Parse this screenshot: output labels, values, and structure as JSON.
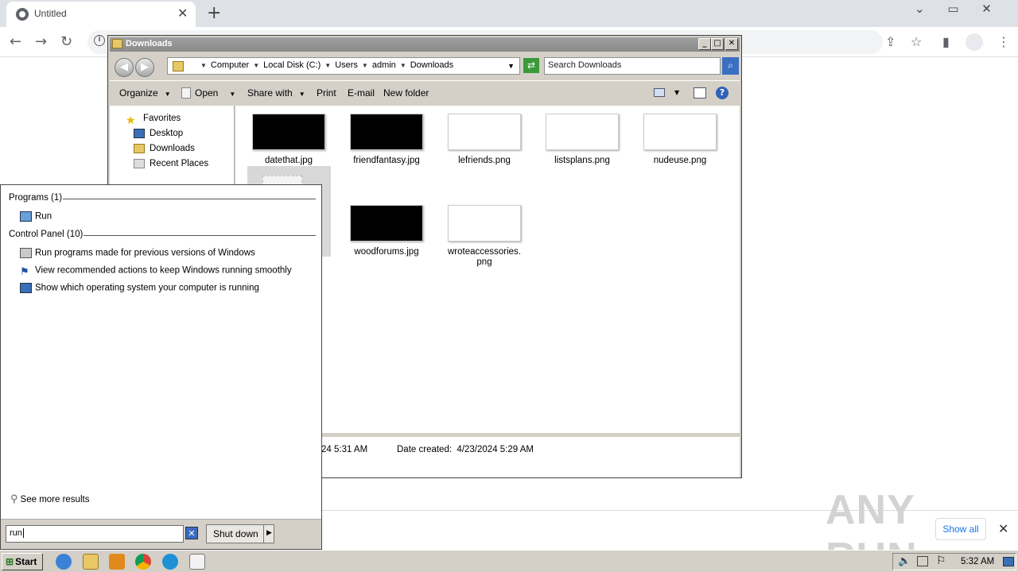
{
  "browser": {
    "tab_title": "Untitled",
    "tab_close": "✕",
    "new_tab": "+",
    "window_controls": "⌄ ▭ ✕",
    "nav": {
      "back": "←",
      "forward": "→",
      "reload": "↻"
    },
    "omni_info": "i"
  },
  "explorer": {
    "title": "Downloads",
    "breadcrumb": [
      "Computer",
      "Local Disk (C:)",
      "Users",
      "admin",
      "Downloads"
    ],
    "search_placeholder": "Search Downloads",
    "commands": {
      "organize": "Organize",
      "open": "Open",
      "share_with": "Share with",
      "print": "Print",
      "email": "E-mail",
      "new_folder": "New folder"
    },
    "nav_pane": {
      "favorites": "Favorites",
      "items": [
        "Desktop",
        "Downloads",
        "Recent Places"
      ]
    },
    "files": [
      {
        "name": "datethat.jpg",
        "thumb": "black"
      },
      {
        "name": "friendfantasy.jpg",
        "thumb": "black"
      },
      {
        "name": "lefriends.png",
        "thumb": "white"
      },
      {
        "name": "listsplans.png",
        "thumb": "white"
      },
      {
        "name": "nudeuse.png",
        "thumb": "white"
      },
      {
        "name": "woodforums.jpg",
        "thumb": "black"
      },
      {
        "name": "wroteaccessories.png",
        "thumb": "white"
      }
    ],
    "details": {
      "modified_partial": "24 5:31 AM",
      "date_created": "Date created:  4/23/2024 5:29 AM"
    }
  },
  "start_menu": {
    "programs_header": "Programs (1)",
    "programs": [
      "Run"
    ],
    "control_panel_header": "Control Panel (10)",
    "control_panel_items": [
      "Run programs made for previous versions of Windows",
      "View recommended actions to keep Windows running smoothly",
      "Show which operating system your computer is running"
    ],
    "see_more": "See more results",
    "search_value": "run",
    "shutdown_label": "Shut down"
  },
  "download_bar": {
    "show_all": "Show all",
    "close": "✕"
  },
  "watermark": "ANY RUN",
  "taskbar": {
    "start_label": "Start",
    "clock": "5:32 AM"
  }
}
